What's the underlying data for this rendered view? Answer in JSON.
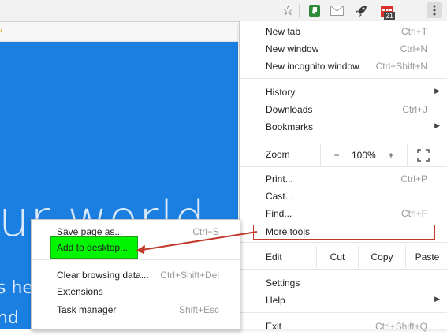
{
  "toolbar": {
    "icons": [
      "bookmark-star-icon",
      "extension-green-icon",
      "mail-icon",
      "rocket-icon",
      "calendar-icon",
      "chrome-menu-icon"
    ],
    "calendar_badge": "21"
  },
  "page": {
    "hero_big": "ur world",
    "hero_small": "s he",
    "hero_small2": "nd"
  },
  "menu": {
    "new_tab": {
      "label": "New tab",
      "shortcut": "Ctrl+T"
    },
    "new_window": {
      "label": "New window",
      "shortcut": "Ctrl+N"
    },
    "new_incognito": {
      "label": "New incognito window",
      "shortcut": "Ctrl+Shift+N"
    },
    "history": {
      "label": "History"
    },
    "downloads": {
      "label": "Downloads",
      "shortcut": "Ctrl+J"
    },
    "bookmarks": {
      "label": "Bookmarks"
    },
    "zoom": {
      "label": "Zoom",
      "minus": "−",
      "value": "100%",
      "plus": "+"
    },
    "print": {
      "label": "Print...",
      "shortcut": "Ctrl+P"
    },
    "cast": {
      "label": "Cast..."
    },
    "find": {
      "label": "Find...",
      "shortcut": "Ctrl+F"
    },
    "more_tools": {
      "label": "More tools"
    },
    "edit": {
      "label": "Edit",
      "cut": "Cut",
      "copy": "Copy",
      "paste": "Paste"
    },
    "settings": {
      "label": "Settings"
    },
    "help": {
      "label": "Help"
    },
    "exit": {
      "label": "Exit",
      "shortcut": "Ctrl+Shift+Q"
    }
  },
  "submenu": {
    "save_page": {
      "label": "Save page as...",
      "shortcut": "Ctrl+S"
    },
    "add_desktop": {
      "label": "Add to desktop..."
    },
    "clear_data": {
      "label": "Clear browsing data...",
      "shortcut": "Ctrl+Shift+Del"
    },
    "extensions": {
      "label": "Extensions"
    },
    "task_manager": {
      "label": "Task manager",
      "shortcut": "Shift+Esc"
    }
  },
  "colors": {
    "hero_bg": "#1a7fe0",
    "highlight": "#00f500",
    "annotation": "#c0392b"
  }
}
